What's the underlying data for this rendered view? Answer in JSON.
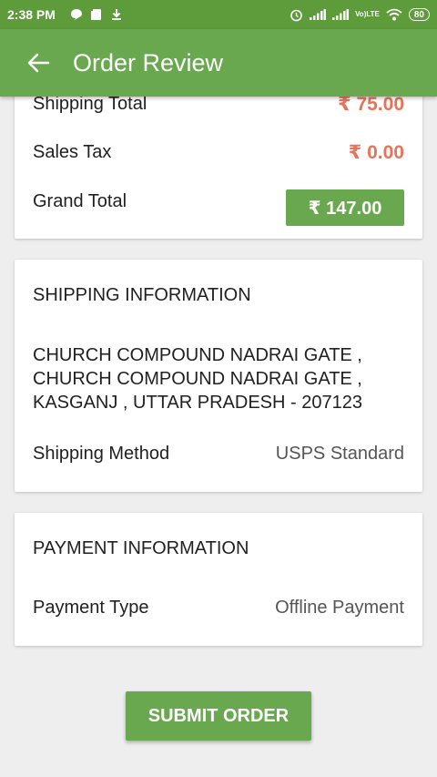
{
  "status_bar": {
    "time": "2:38 PM",
    "battery": "80",
    "volte_top": "Vo)",
    "volte_bottom": "LTE"
  },
  "app_bar": {
    "title": "Order Review",
    "back_icon": "arrow-left-icon"
  },
  "totals": {
    "shipping_label": "Shipping Total",
    "shipping_value": "₹ 75.00",
    "tax_label": "Sales Tax",
    "tax_value": "₹ 0.00",
    "grand_label": "Grand Total",
    "grand_value": "₹ 147.00"
  },
  "shipping": {
    "heading": "SHIPPING INFORMATION",
    "address_lines": [
      "CHURCH COMPOUND NADRAI GATE ,",
      "CHURCH COMPOUND NADRAI GATE ,",
      "KASGANJ , UTTAR PRADESH - 207123"
    ],
    "method_label": "Shipping Method",
    "method_value": "USPS Standard"
  },
  "payment": {
    "heading": "PAYMENT INFORMATION",
    "type_label": "Payment Type",
    "type_value": "Offline Payment"
  },
  "submit_label": "SUBMIT ORDER",
  "colors": {
    "primary": "#6aa84f",
    "status_bar": "#5e9b3a",
    "amount": "#e8735a"
  }
}
